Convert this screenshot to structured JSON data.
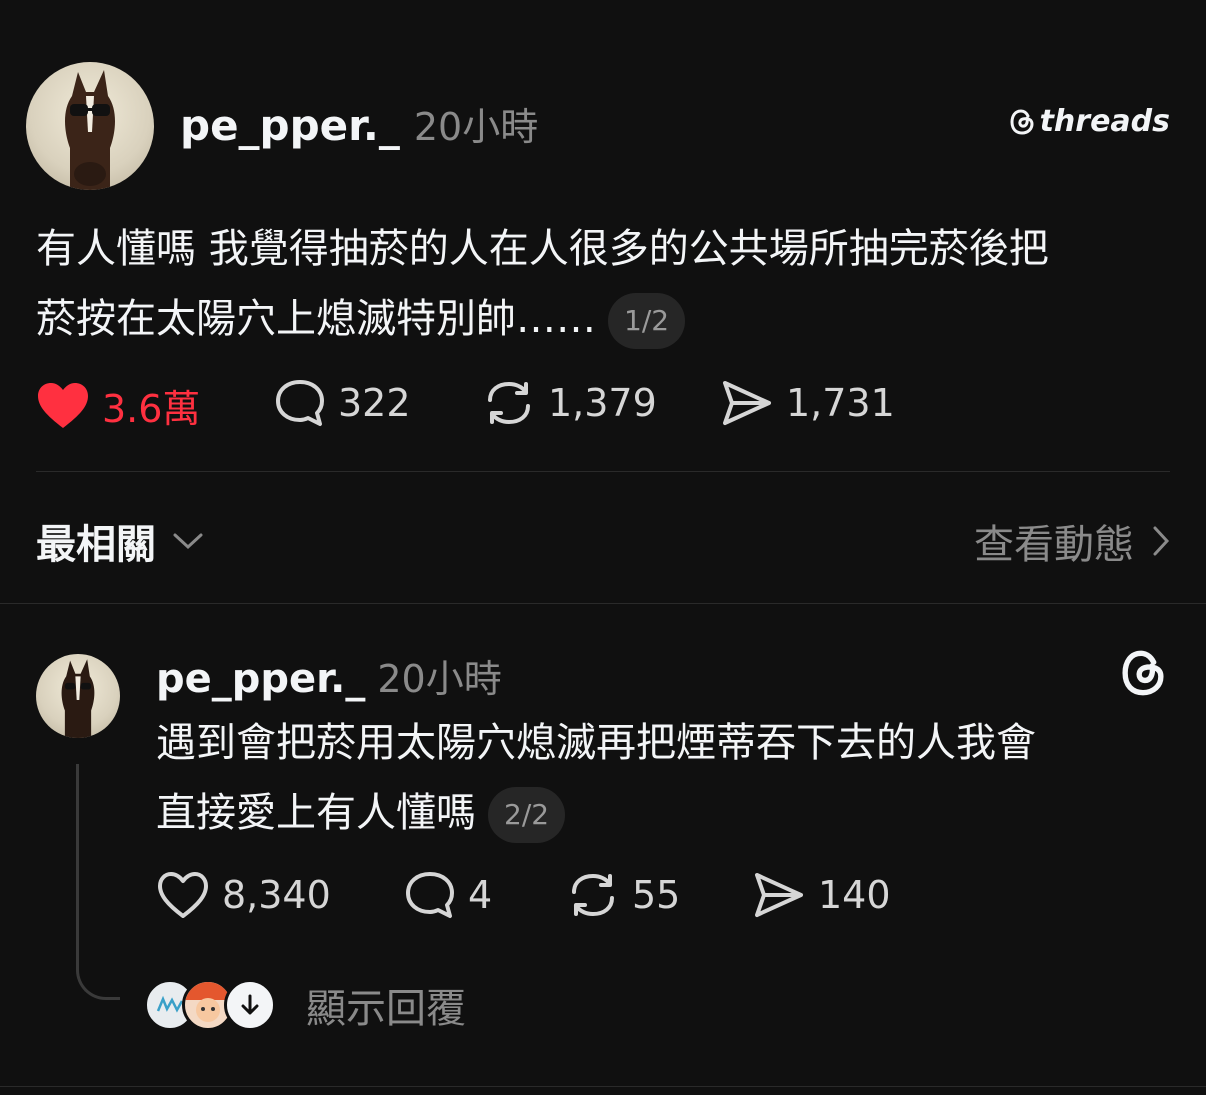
{
  "main_post": {
    "username": "pe_pper._",
    "time": "20小時",
    "brand": "threads",
    "text_line1": "有人懂嗎 我覺得抽菸的人在人很多的公共場所抽完菸後把",
    "text_line2": "菸按在太陽穴上熄滅特別帥……",
    "pager": "1/2",
    "likes": "3.6萬",
    "comments": "322",
    "reposts": "1,379",
    "shares": "1,731",
    "liked": true
  },
  "sort_bar": {
    "label": "最相關",
    "activity_label": "查看動態"
  },
  "reply": {
    "username": "pe_pper._",
    "time": "20小時",
    "text_line1": "遇到會把菸用太陽穴熄滅再把煙蒂吞下去的人我會",
    "text_line2": "直接愛上有人懂嗎",
    "pager": "2/2",
    "likes": "8,340",
    "comments": "4",
    "reposts": "55",
    "shares": "140",
    "show_replies_label": "顯示回覆"
  },
  "colors": {
    "background": "#101010",
    "like_red": "#ff3040",
    "muted": "#8a8a8a"
  }
}
